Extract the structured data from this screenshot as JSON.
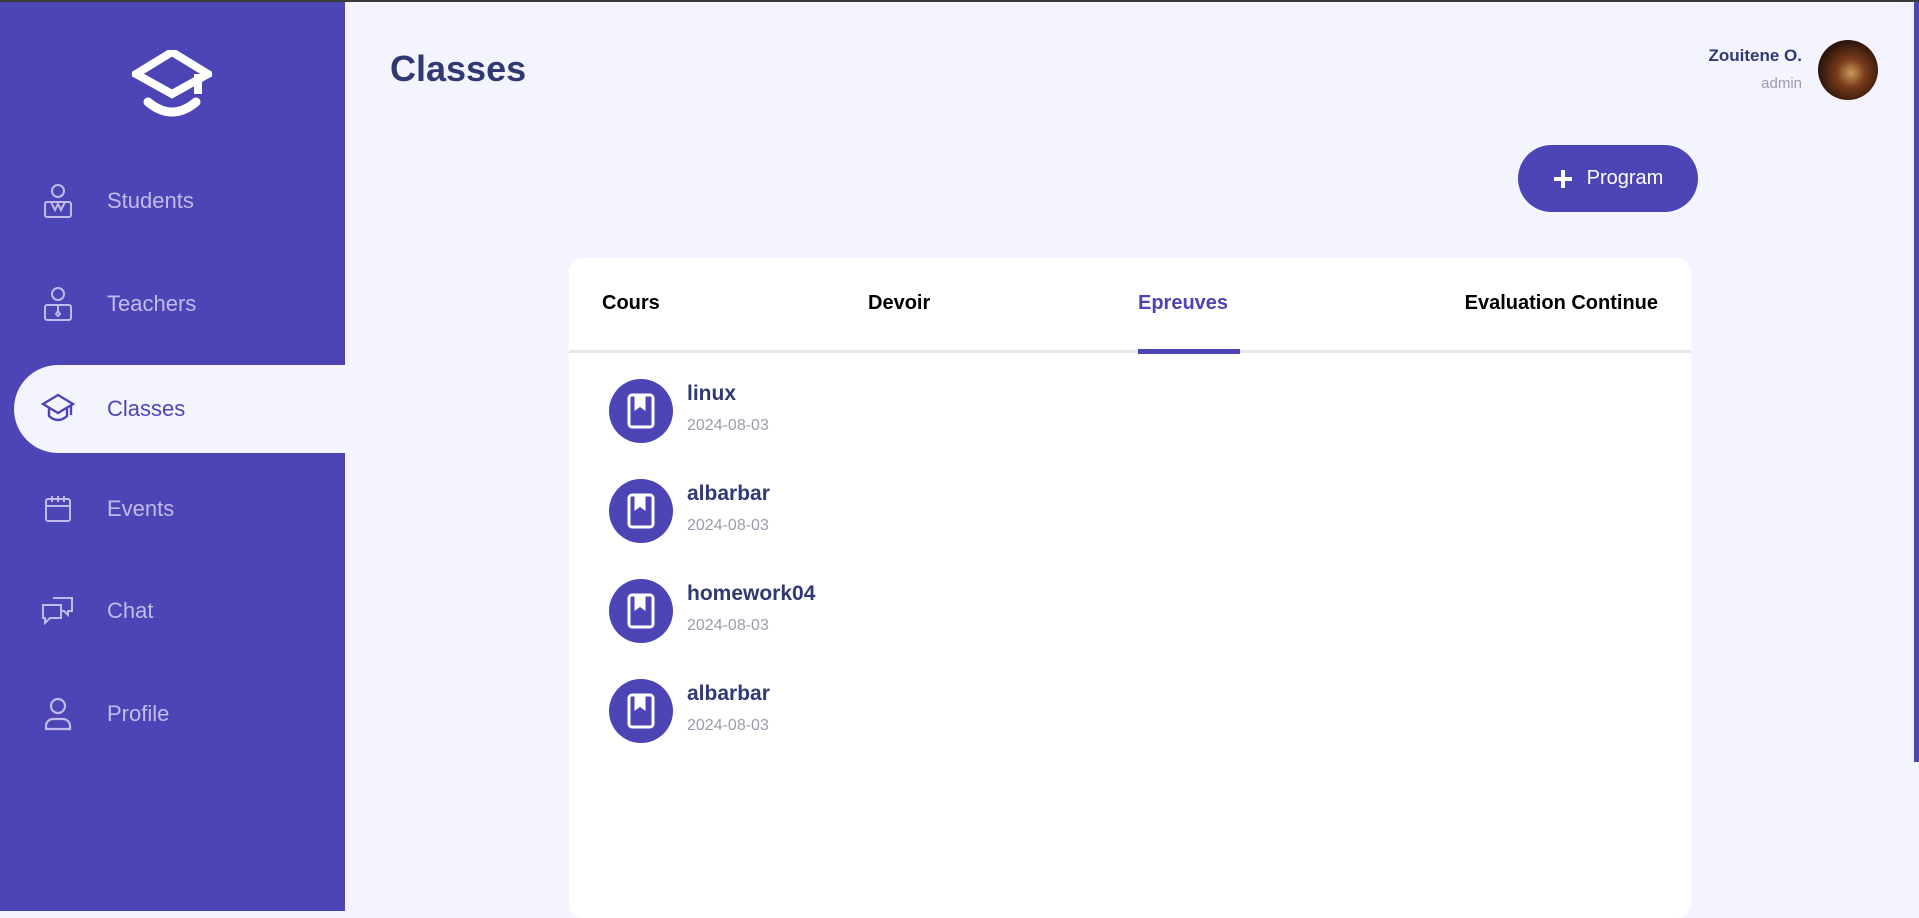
{
  "header": {
    "title": "Classes",
    "user_name": "Zouitene O.",
    "user_role": "admin"
  },
  "sidebar": {
    "items": [
      {
        "label": "Students",
        "icon": "student-icon"
      },
      {
        "label": "Teachers",
        "icon": "teacher-icon"
      },
      {
        "label": "Classes",
        "icon": "graduation-cap-icon",
        "active": true
      },
      {
        "label": "Events",
        "icon": "calendar-icon"
      },
      {
        "label": "Chat",
        "icon": "chat-icon"
      },
      {
        "label": "Profile",
        "icon": "user-icon"
      }
    ]
  },
  "toolbar": {
    "program_label": "Program"
  },
  "tabs": [
    {
      "label": "Cours"
    },
    {
      "label": "Devoir"
    },
    {
      "label": "Epreuves",
      "active": true
    },
    {
      "label": "Evaluation Continue"
    }
  ],
  "items": [
    {
      "title": "linux",
      "date": "2024-08-03"
    },
    {
      "title": "albarbar",
      "date": "2024-08-03"
    },
    {
      "title": "homework04",
      "date": "2024-08-03"
    },
    {
      "title": "albarbar",
      "date": "2024-08-03"
    }
  ],
  "colors": {
    "primary": "#4d44b5",
    "background": "#f4f4fe",
    "heading": "#303972",
    "muted": "#a098ae"
  }
}
